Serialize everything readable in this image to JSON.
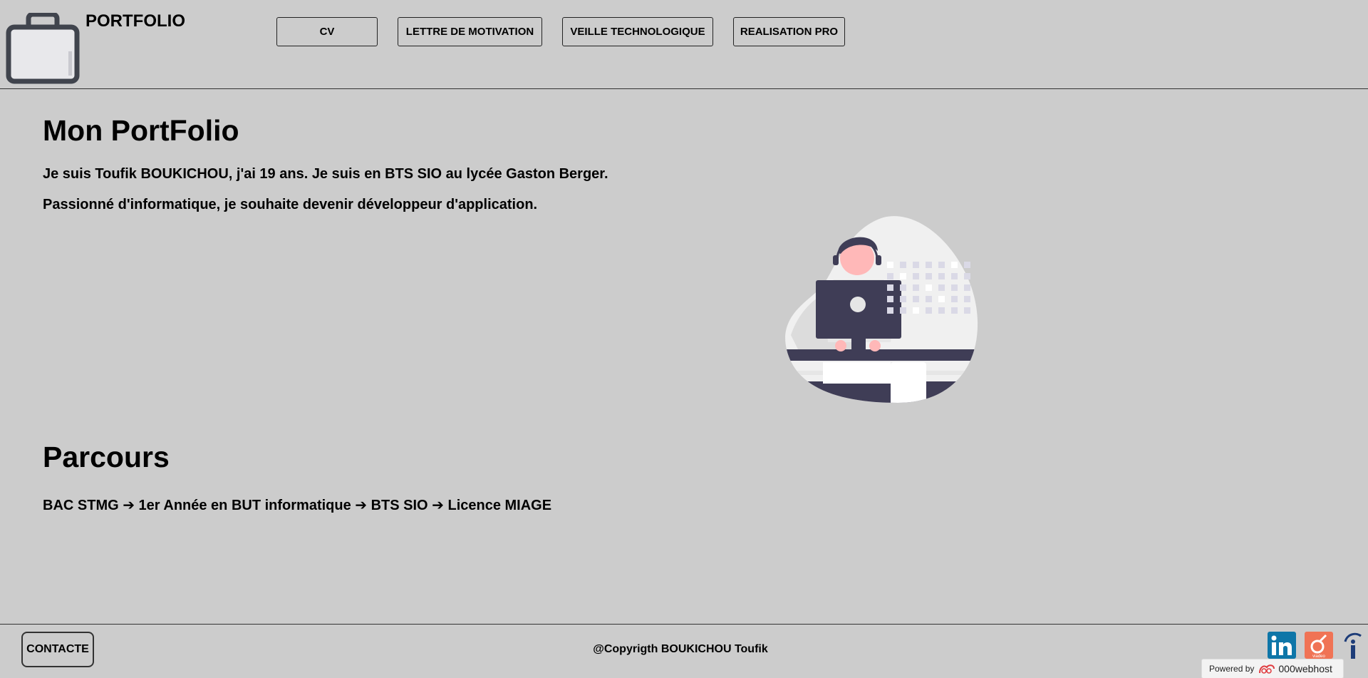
{
  "header": {
    "title": "PORTFOLIO",
    "nav": [
      {
        "label": "CV"
      },
      {
        "label": "LETTRE DE MOTIVATION"
      },
      {
        "label": "VEILLE TECHNOLOGIQUE"
      },
      {
        "label": "REALISATION PRO"
      }
    ]
  },
  "main": {
    "heading": "Mon PortFolio",
    "intro_line1": "Je suis Toufik BOUKICHOU, j'ai 19 ans. Je suis en BTS SIO au lycée Gaston Berger.",
    "intro_line2": "Passionné d'informatique, je souhaite devenir développeur d'application.",
    "parcours_heading": "Parcours",
    "parcours_text": "BAC STMG ➔ 1er Année en BUT informatique ➔ BTS SIO ➔ Licence MIAGE"
  },
  "footer": {
    "contact_label": "CONTACTE",
    "copyright": "@Copyrigth BOUKICHOU Toufik",
    "powered_by": "Powered by",
    "host_brand": "000webhost"
  },
  "icons": {
    "logo": "briefcase-icon",
    "social": [
      "linkedin-icon",
      "viadeo-icon",
      "info-icon"
    ]
  },
  "colors": {
    "background": "#cccccc",
    "dark": "#3f3d56",
    "skin": "#ffb8b8",
    "linkedin": "#0e76a8",
    "viadeo": "#f07355"
  }
}
